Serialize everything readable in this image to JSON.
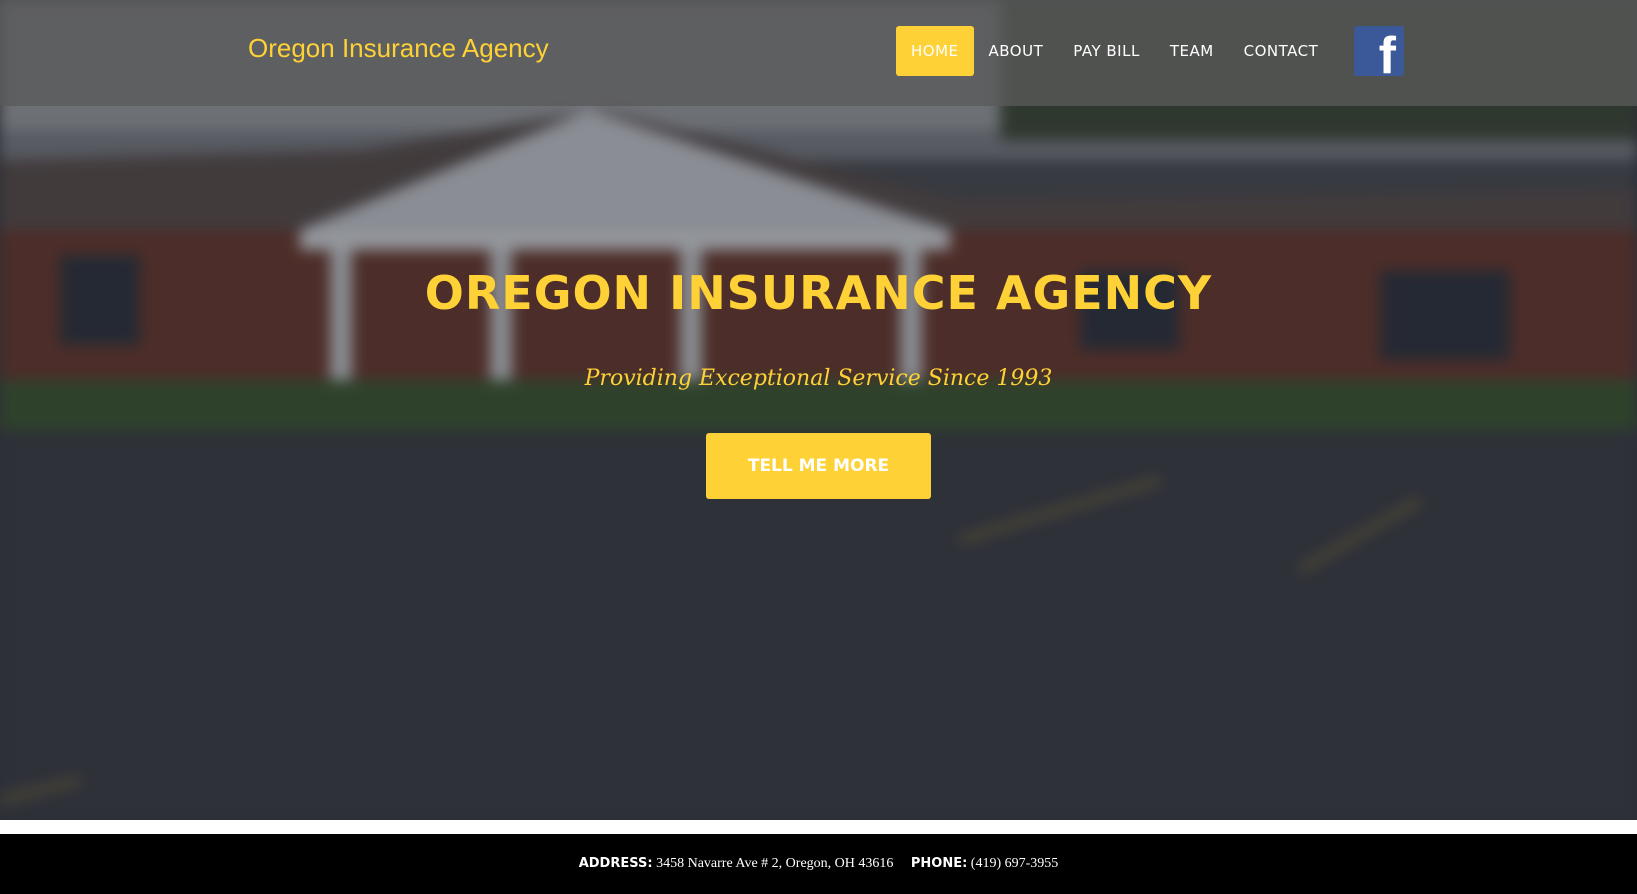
{
  "brand": "Oregon Insurance Agency",
  "nav": {
    "home": "HOME",
    "about": "ABOUT",
    "pay_bill": "PAY BILL",
    "team": "TEAM",
    "contact": "CONTACT"
  },
  "social": {
    "facebook_glyph": "f",
    "icon": "facebook-icon"
  },
  "hero": {
    "title": "OREGON INSURANCE AGENCY",
    "subtitle": "Providing Exceptional Service Since 1993",
    "cta_label": "TELL ME MORE"
  },
  "footer": {
    "address_label": "ADDRESS:",
    "address_value": "3458 Navarre Ave # 2, Oregon, OH 43616",
    "phone_label": "PHONE:",
    "phone_value": "(419) 697-3955"
  },
  "colors": {
    "accent": "#fed136",
    "facebook": "#3b5998",
    "footer_bg": "#000000"
  }
}
